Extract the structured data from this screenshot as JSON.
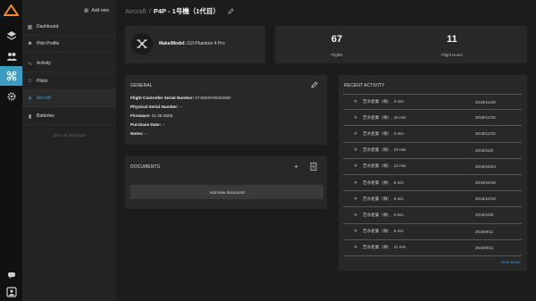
{
  "sidenav": {
    "add_new": "Add new",
    "items": [
      {
        "label": "Dashboard",
        "icon": "dashboard-icon"
      },
      {
        "label": "Pilot Profile",
        "icon": "pilot-icon"
      },
      {
        "label": "Activity",
        "icon": "activity-icon"
      },
      {
        "label": "Pilots",
        "icon": "pilots-icon"
      },
      {
        "label": "Aircraft",
        "icon": "aircraft-icon"
      },
      {
        "label": "Batteries",
        "icon": "battery-icon"
      }
    ],
    "feedback": "Give us feedback",
    "active_color": "#3d95c8"
  },
  "breadcrumb": {
    "parent": "Aircraft",
    "separator": "/",
    "current": "P4P - 1号機（1代目）"
  },
  "model": {
    "label": "Make/Model:",
    "value": "DJI Phantom 4 Pro"
  },
  "stats": {
    "flights_value": "67",
    "flights_label": "Flights",
    "hours_value": "11",
    "hours_label": "Flight Hours"
  },
  "general": {
    "title": "GENERAL",
    "rows": [
      {
        "label": "Flight Controller Serial Number:",
        "value": "07JDE9V00201MD"
      },
      {
        "label": "Physical Serial Number:",
        "value": "--"
      },
      {
        "label": "Firmware:",
        "value": "01.05.0600"
      },
      {
        "label": "Purchase Date:",
        "value": "--"
      },
      {
        "label": "Notes:",
        "value": "--"
      }
    ]
  },
  "documents": {
    "title": "DOCUMENTS",
    "add_button": "Add new document"
  },
  "recent": {
    "title": "RECENT ACTIVITY",
    "items": [
      {
        "name": "芝水産業（株）, 3 min",
        "date": "2019/11/26"
      },
      {
        "name": "芝水産業（株）, 16 min",
        "date": "2019/11/26"
      },
      {
        "name": "芝水産業（株）, 0 min",
        "date": "2019/11/20"
      },
      {
        "name": "芝水産業（株）, 23 min",
        "date": "2019/11/8"
      },
      {
        "name": "芝水産業（株）, 12 min",
        "date": "2019/10/24"
      },
      {
        "name": "芝水産業（株）, 5 min",
        "date": "2019/10/16"
      },
      {
        "name": "芝水産業（株）, 0 min",
        "date": "2019/10/10"
      },
      {
        "name": "芝水産業（株）, 0 min",
        "date": "2019/10/8"
      },
      {
        "name": "芝水産業（株）, 6 min",
        "date": "2019/9/11"
      },
      {
        "name": "芝水産業（株）, 11 min",
        "date": "2019/9/11"
      }
    ],
    "view_more": "View More"
  },
  "colors": {
    "accent": "#3c9cc3",
    "logo": "#f0892e"
  }
}
